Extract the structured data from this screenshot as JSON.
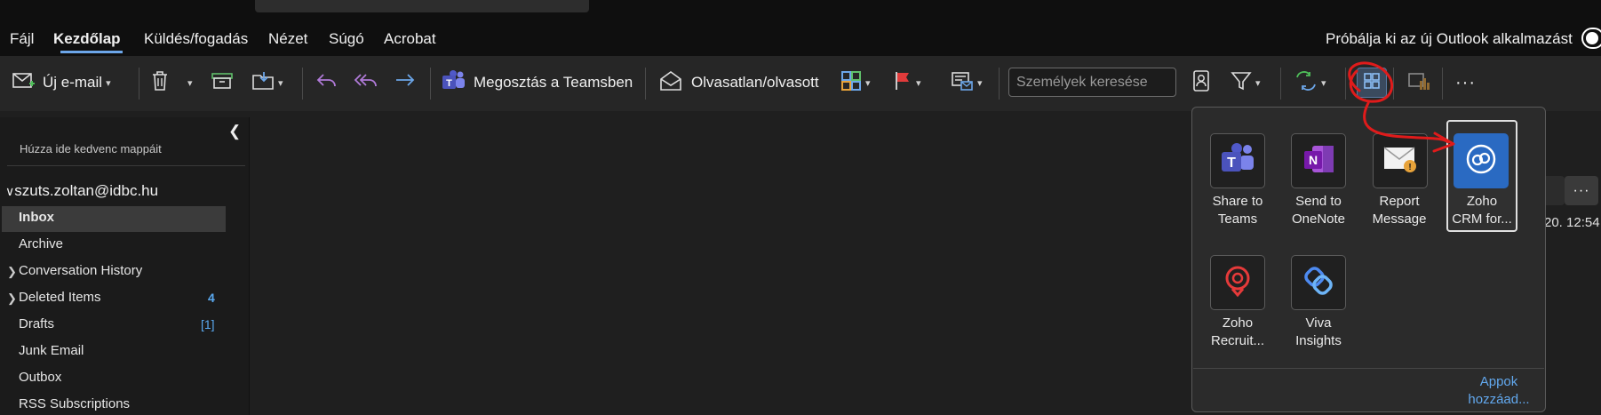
{
  "menu": [
    "Fájl",
    "Kezdőlap",
    "Küldés/fogadás",
    "Nézet",
    "Súgó",
    "Acrobat"
  ],
  "try_new": "Próbálja ki az új Outlook alkalmazást",
  "ribbon": {
    "new_email": "Új e-mail",
    "share_teams": "Megosztás a Teamsben",
    "read_unread": "Olvasatlan/olvasott",
    "people_search_placeholder": "Személyek keresése",
    "more": "···"
  },
  "sidebar": {
    "fav_hint": "Húzza ide kedvenc mappáit",
    "account": "szuts.zoltan@idbc.hu",
    "folders": [
      {
        "name": "Inbox",
        "count": ""
      },
      {
        "name": "Archive",
        "count": ""
      },
      {
        "name": "Conversation History",
        "count": ""
      },
      {
        "name": "Deleted Items",
        "count": "4"
      },
      {
        "name": "Drafts",
        "count": "[1]"
      },
      {
        "name": "Junk Email",
        "count": ""
      },
      {
        "name": "Outbox",
        "count": ""
      },
      {
        "name": "RSS Subscriptions",
        "count": ""
      }
    ]
  },
  "apps_popup": {
    "apps": [
      {
        "line1": "Share to",
        "line2": "Teams",
        "icon": "teams-icon"
      },
      {
        "line1": "Send to",
        "line2": "OneNote",
        "icon": "onenote-icon"
      },
      {
        "line1": "Report",
        "line2": "Message",
        "icon": "report-message-icon"
      },
      {
        "line1": "Zoho",
        "line2": "CRM for...",
        "icon": "zoho-crm-icon"
      },
      {
        "line1": "Zoho",
        "line2": "Recruit...",
        "icon": "zoho-recruit-icon"
      },
      {
        "line1": "Viva",
        "line2": "Insights",
        "icon": "viva-insights-icon"
      }
    ],
    "add_apps_line1": "Appok",
    "add_apps_line2": "hozzáad..."
  },
  "reading_edge": {
    "more": "···",
    "time": "20.  12:54"
  },
  "colors": {
    "accent": "#6ca6e9",
    "annotation": "#e01b1b",
    "count": "#5aa9f0"
  }
}
